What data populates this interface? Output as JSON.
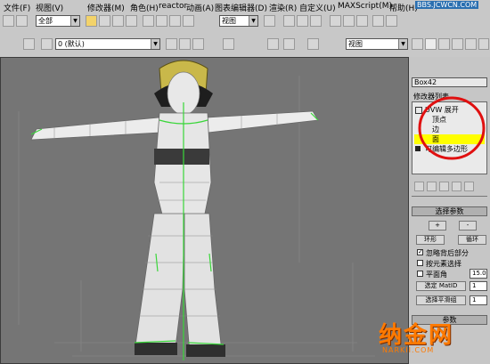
{
  "menubar": {
    "items": [
      "文件(F)",
      "视图(V)",
      "修改器(M)",
      "角色(H)",
      "reactor",
      "动画(A)",
      "图表编辑器(D)",
      "渲染(R)",
      "自定义(U)",
      "MAXScript(M)",
      "帮助(H)"
    ]
  },
  "toolbar1": {
    "selection_filter": "全部",
    "ref_coord": "视图"
  },
  "toolbar2": {
    "layer_value": "0 (默认)",
    "view_combo": "视图"
  },
  "watermark_top": "BBS.JCWCN.COM",
  "command_panel": {
    "object_name": "Box42",
    "modifier_list_label": "修改器列表",
    "stack": [
      "UVW 展开",
      "顶点",
      "边",
      "面",
      "可编辑多边形"
    ],
    "selection_rollout": "选择参数",
    "plus": "+",
    "minus": "-",
    "ring": "环形",
    "loop": "循环",
    "ignore_backfaces": "忽略背后部分",
    "select_by_element": "按元素选择",
    "planar_angle": "平面角",
    "planar_angle_value": "15.0",
    "select_matid": "选定 MatID",
    "matid_value": "1",
    "select_smoothing": "选择平滑组",
    "smoothing_value": "1",
    "params_rollout": "参数"
  },
  "watermark_logo": "纳金网",
  "watermark_logo_sub": "NARKII.COM",
  "colors": {
    "menubar": "#c8c8c8",
    "viewport": "#757575",
    "highlight_item": "#ffff00",
    "annotation_circle": "#e01010",
    "selected_edges": "#39d639",
    "watermark": "#ff7a00"
  }
}
